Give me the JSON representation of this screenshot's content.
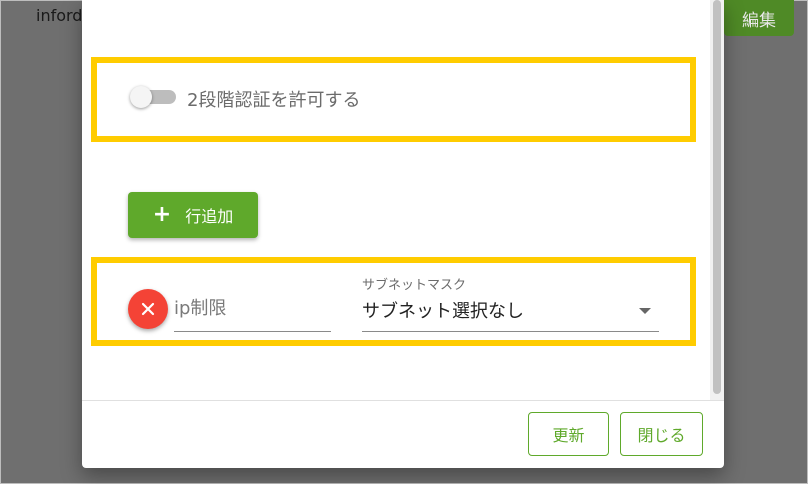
{
  "background": {
    "partial_text": "inford",
    "edit_button_label": "編集"
  },
  "dialog": {
    "two_factor": {
      "label": "2段階認証を許可する",
      "enabled": false
    },
    "add_row_button": {
      "label": "行追加",
      "icon": "plus-icon"
    },
    "ip_row": {
      "ip_placeholder": "ip制限",
      "ip_value": "",
      "subnet_label": "サブネットマスク",
      "subnet_value": "サブネット選択なし"
    },
    "footer": {
      "update_label": "更新",
      "close_label": "閉じる"
    }
  },
  "colors": {
    "accent_green": "#5fa92b",
    "highlight_yellow": "#ffcc00",
    "remove_red": "#f44336"
  }
}
